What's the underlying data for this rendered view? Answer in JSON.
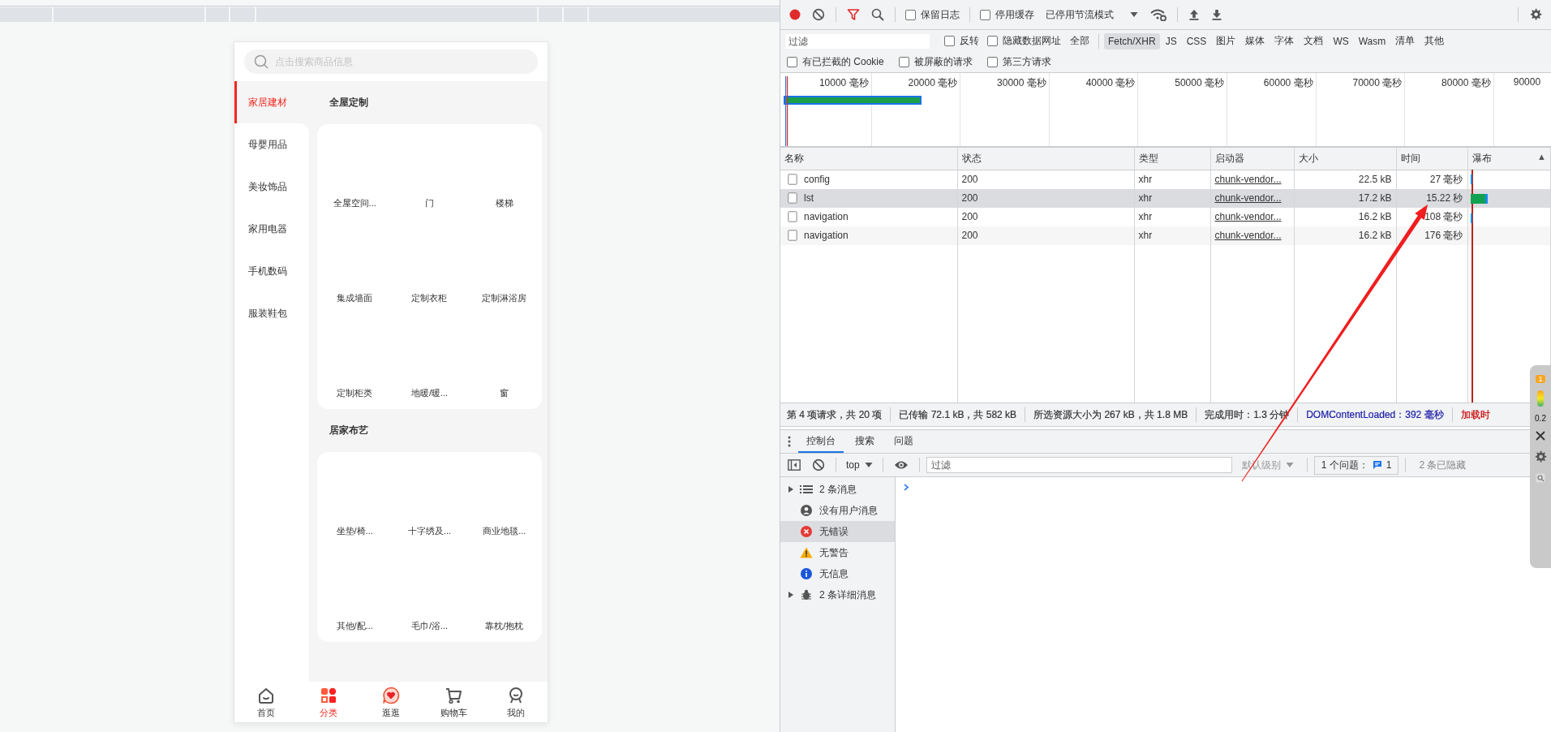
{
  "preview": {
    "search": {
      "placeholder": "点击搜索商品信息"
    },
    "categories": [
      {
        "label": "家居建材",
        "selected": true
      },
      {
        "label": "母婴用品",
        "selected": false
      },
      {
        "label": "美妆饰品",
        "selected": false
      },
      {
        "label": "家用电器",
        "selected": false
      },
      {
        "label": "手机数码",
        "selected": false
      },
      {
        "label": "服装鞋包",
        "selected": false
      }
    ],
    "sections": [
      {
        "title": "全屋定制",
        "items": [
          "全屋空间...",
          "门",
          "楼梯",
          "集成墙面",
          "定制衣柜",
          "定制淋浴房",
          "定制柜类",
          "地暖/暖...",
          "窗"
        ]
      },
      {
        "title": "居家布艺",
        "items": [
          "坐垫/椅...",
          "十字绣及...",
          "商业地毯...",
          "其他/配...",
          "毛巾/浴...",
          "靠枕/抱枕"
        ]
      }
    ],
    "tabbar": [
      {
        "label": "首页",
        "kind": "home",
        "selected": false
      },
      {
        "label": "分类",
        "kind": "category",
        "selected": true
      },
      {
        "label": "逛逛",
        "kind": "discover",
        "selected": false
      },
      {
        "label": "购物车",
        "kind": "cart",
        "selected": false
      },
      {
        "label": "我的",
        "kind": "profile",
        "selected": false
      }
    ]
  },
  "devtools": {
    "toolbar": {
      "recording": true,
      "filter_shown": true,
      "preserve_log": {
        "label": "保留日志",
        "checked": false
      },
      "disable_cache": {
        "label": "停用缓存",
        "checked": false
      },
      "throttling": "已停用节流模式"
    },
    "filter": {
      "placeholder": "过滤",
      "invert": {
        "label": "反转",
        "checked": false
      },
      "hide_data_urls": {
        "label": "隐藏数据网址",
        "checked": false
      },
      "types": [
        {
          "label": "全部",
          "selected": false
        },
        {
          "label": "Fetch/XHR",
          "selected": true
        },
        {
          "label": "JS",
          "selected": false
        },
        {
          "label": "CSS",
          "selected": false
        },
        {
          "label": "图片",
          "selected": false
        },
        {
          "label": "媒体",
          "selected": false
        },
        {
          "label": "字体",
          "selected": false
        },
        {
          "label": "文档",
          "selected": false
        },
        {
          "label": "WS",
          "selected": false
        },
        {
          "label": "Wasm",
          "selected": false
        },
        {
          "label": "清单",
          "selected": false
        },
        {
          "label": "其他",
          "selected": false
        }
      ]
    },
    "more_filters": [
      {
        "label": "有已拦截的 Cookie",
        "checked": false
      },
      {
        "label": "被屏蔽的请求",
        "checked": false
      },
      {
        "label": "第三方请求",
        "checked": false
      }
    ],
    "overview": {
      "ticks": [
        "10000 毫秒",
        "20000 毫秒",
        "30000 毫秒",
        "40000 毫秒",
        "50000 毫秒",
        "60000 毫秒",
        "70000 毫秒",
        "80000 毫秒",
        "90000"
      ]
    },
    "table": {
      "columns": [
        "名称",
        "状态",
        "类型",
        "启动器",
        "大小",
        "时间",
        "瀑布"
      ],
      "sort_indicator": "▲",
      "rows": [
        {
          "name": "config",
          "status": "200",
          "type": "xhr",
          "initiator": "chunk-vendor...",
          "size": "22.5 kB",
          "time": "27 毫秒",
          "selected": false
        },
        {
          "name": "lst",
          "status": "200",
          "type": "xhr",
          "initiator": "chunk-vendor...",
          "size": "17.2 kB",
          "time": "15.22 秒",
          "selected": true
        },
        {
          "name": "navigation",
          "status": "200",
          "type": "xhr",
          "initiator": "chunk-vendor...",
          "size": "16.2 kB",
          "time": "108 毫秒",
          "selected": false
        },
        {
          "name": "navigation",
          "status": "200",
          "type": "xhr",
          "initiator": "chunk-vendor...",
          "size": "16.2 kB",
          "time": "176 毫秒",
          "selected": false
        }
      ]
    },
    "status_bar": [
      {
        "text": "第 4 项请求，共 20 项",
        "color": "#333333"
      },
      {
        "text": "已传输 72.1 kB，共 582 kB",
        "color": "#333333"
      },
      {
        "text": "所选资源大小为 267 kB，共 1.8 MB",
        "color": "#333333"
      },
      {
        "text": "完成用时：1.3 分钟",
        "color": "#333333"
      },
      {
        "text": "DOMContentLoaded：392 毫秒",
        "color": "#1a1aa6"
      },
      {
        "text": "加载时",
        "color": "#c80000"
      }
    ],
    "drawer": {
      "tabs": [
        {
          "label": "控制台",
          "selected": true
        },
        {
          "label": "搜索",
          "selected": false
        },
        {
          "label": "问题",
          "selected": false
        }
      ],
      "context": "top",
      "filter_placeholder": "过滤",
      "level": "默认级别",
      "issues": "1 个问题：",
      "issues_count": "1",
      "hidden": "2 条已隐藏",
      "sidebar": [
        {
          "label": "2 条消息",
          "kind": "list",
          "expandable": true,
          "selected": false
        },
        {
          "label": "没有用户消息",
          "kind": "user",
          "expandable": false,
          "selected": false
        },
        {
          "label": "无错误",
          "kind": "error",
          "expandable": false,
          "selected": true
        },
        {
          "label": "无警告",
          "kind": "warning",
          "expandable": false,
          "selected": false
        },
        {
          "label": "无信息",
          "kind": "info",
          "expandable": false,
          "selected": false
        },
        {
          "label": "2 条详细消息",
          "kind": "verbose",
          "expandable": true,
          "selected": false
        }
      ]
    }
  },
  "side_widget": {
    "badge": "1",
    "reading": "0.2"
  }
}
